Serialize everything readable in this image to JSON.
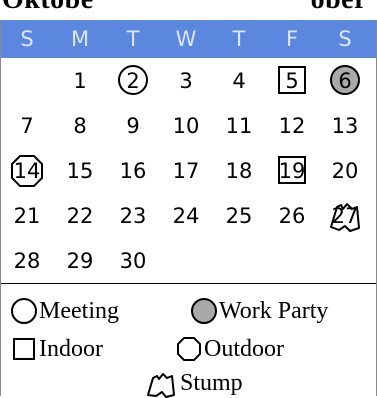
{
  "top_banner": {
    "left_text": "Oktobe",
    "right_text": "ober"
  },
  "weekdays": [
    "S",
    "M",
    "T",
    "W",
    "T",
    "F",
    "S"
  ],
  "days": {
    "1": "1",
    "2": "2",
    "3": "3",
    "4": "4",
    "5": "5",
    "6": "6",
    "7": "7",
    "8": "8",
    "9": "9",
    "10": "10",
    "11": "11",
    "12": "12",
    "13": "13",
    "14": "14",
    "15": "15",
    "16": "16",
    "17": "17",
    "18": "18",
    "19": "19",
    "20": "20",
    "21": "21",
    "22": "22",
    "23": "23",
    "24": "24",
    "25": "25",
    "26": "26",
    "27": "27",
    "28": "28",
    "29": "29",
    "30": "30"
  },
  "legend": {
    "meeting": "Meeting",
    "work_party": "Work Party",
    "indoor": "Indoor",
    "outdoor": "Outdoor",
    "stump": "Stump"
  },
  "colors": {
    "header_blue": "#5c87df",
    "header_text": "#dce7ff",
    "work_party_gray": "#a9a9a9",
    "ink": "#000000",
    "background": "#ffffff"
  },
  "icons": {
    "meeting": "circle-icon",
    "work_party": "filled-circle-icon",
    "indoor": "square-icon",
    "outdoor": "octagon-icon",
    "stump": "stump-icon"
  }
}
